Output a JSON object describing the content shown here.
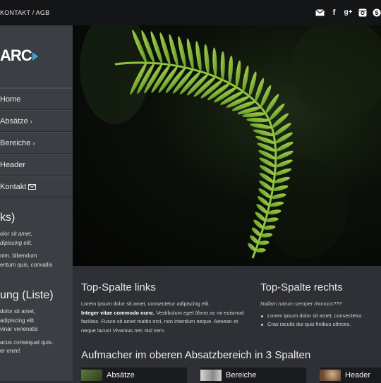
{
  "topbar": {
    "links": "KONTAKT / AGB",
    "social_icons": [
      "mail-icon",
      "facebook-icon",
      "google-plus-icon",
      "instagram-icon",
      "skype-icon"
    ]
  },
  "sidebar": {
    "logo": "ARC",
    "nav": [
      {
        "label": "Home",
        "icon": null
      },
      {
        "label": "Absätze",
        "icon": "chevron-right-icon"
      },
      {
        "label": "Bereiche",
        "icon": "chevron-right-icon"
      },
      {
        "label": "Header",
        "icon": null
      },
      {
        "label": "Kontakt",
        "icon": "envelope-icon"
      }
    ],
    "widget1": {
      "title": "ks)",
      "line1": "olor sit amet,",
      "line2": "dipiscing elit.",
      "line3": "nim, bibendum",
      "line4": "entum quis, convallis"
    },
    "widget2": {
      "title": "ung (Liste)",
      "line1": "dolor sit amet,",
      "line2": "adipiscing elit.",
      "line3": "vinar venenatis",
      "line4": "acus consequat quis.",
      "line5": "er enim!"
    }
  },
  "content": {
    "left": {
      "title": "Top-Spalte links",
      "p1": "Lorem ipsum dolor sit amet, consectetur adipiscing elit.",
      "bold": "Integer vitae commodo nunc.",
      "p2": " Vestibulum ",
      "italic": "eget libero ac",
      "p3": " mi euismod facilisis. Fusce sit amet mattis orci, non interdum neque. Aenean et neque lacus! Vivamus nec nisl sem."
    },
    "right": {
      "title": "Top-Spalte rechts",
      "subtitle": "Nullam rutrum semper rhoncus???",
      "items": [
        "Lorem ipsum dolor sit amet, consectetur.",
        "Cras iaculis dui quis finibus ultrices."
      ]
    },
    "section_title": "Aufmacher im oberen Absatzbereich in 3 Spalten",
    "cards": [
      "Absätze",
      "Bereiche",
      "Header"
    ]
  },
  "colors": {
    "accent": "#3aa7d8",
    "fern": "#8cc63f",
    "sidebar": "#3b3e43",
    "content_bg": "#2e3035"
  }
}
